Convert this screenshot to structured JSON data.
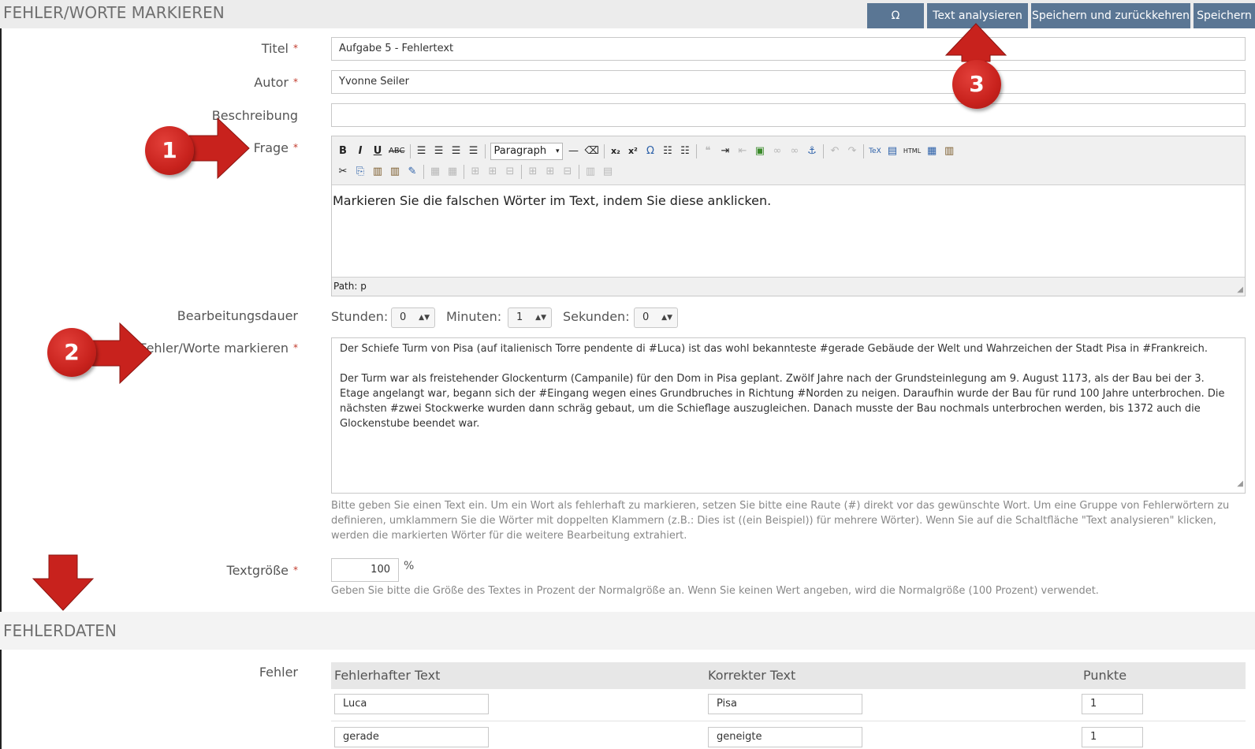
{
  "header": {
    "title": "FEHLER/WORTE MARKIEREN",
    "buttons": {
      "omega": "Ω",
      "analyze": "Text analysieren",
      "save_return": "Speichern und zurückkehren",
      "save": "Speichern"
    }
  },
  "form": {
    "titel": {
      "label": "Titel",
      "required_mark": "*",
      "value": "Aufgabe 5 - Fehlertext"
    },
    "autor": {
      "label": "Autor",
      "required_mark": "*",
      "value": "Yvonne Seiler"
    },
    "beschreibung": {
      "label": "Beschreibung",
      "value": ""
    },
    "frage": {
      "label": "Frage",
      "required_mark": "*",
      "paragraph_format": "Paragraph",
      "content": "Markieren Sie die falschen Wörter im Text, indem Sie diese anklicken.",
      "path": "Path: p"
    },
    "bearbeitungsdauer": {
      "label": "Bearbeitungsdauer",
      "stunden_label": "Stunden:",
      "stunden_value": "0",
      "minuten_label": "Minuten:",
      "minuten_value": "1",
      "sekunden_label": "Sekunden:",
      "sekunden_value": "0"
    },
    "fehler_worte": {
      "label": "Fehler/Worte markieren",
      "required_mark": "*",
      "paragraph1": "Der Schiefe Turm von Pisa (auf italienisch Torre pendente di #Luca) ist das wohl bekannteste #gerade Gebäude der Welt und Wahrzeichen der Stadt Pisa in #Frankreich.",
      "paragraph2": "Der Turm war als freistehender Glockenturm (Campanile) für den Dom in Pisa geplant. Zwölf Jahre nach der Grundsteinlegung am 9. August 1173, als der Bau bei der 3. Etage angelangt war, begann sich der #Eingang wegen eines Grundbruches in Richtung #Norden zu neigen. Daraufhin wurde der Bau für rund 100 Jahre unterbrochen. Die nächsten #zwei Stockwerke wurden dann schräg gebaut, um die Schieflage auszugleichen. Danach musste der Bau nochmals unterbrochen werden, bis 1372 auch die Glockenstube beendet war.",
      "help_line1": "Bitte geben Sie einen Text ein. Um ein Wort als fehlerhaft zu markieren, setzen Sie bitte eine Raute (#) direkt vor das gewünschte Wort. Um eine Gruppe von Fehlerwörtern zu",
      "help_line2": "definieren, umklammern Sie die Wörter mit doppelten Klammern (z.B.: Dies ist ((ein Beispiel)) für mehrere Wörter). Wenn Sie auf die Schaltfläche \"Text analysieren\" klicken,",
      "help_line3": "werden die markierten Wörter für die weitere Bearbeitung extrahiert."
    },
    "textgroesse": {
      "label": "Textgröße",
      "required_mark": "*",
      "value": "100",
      "unit": "%",
      "help": "Geben Sie bitte die Größe des Textes in Prozent der Normalgröße an. Wenn Sie keinen Wert angeben, wird die Normalgröße (100 Prozent) verwendet."
    }
  },
  "fehlerdaten": {
    "section_title": "FEHLERDATEN",
    "label": "Fehler",
    "columns": [
      "Fehlerhafter Text",
      "Korrekter Text",
      "Punkte"
    ],
    "rows": [
      {
        "wrong": "Luca",
        "correct": "Pisa",
        "points": "1"
      },
      {
        "wrong": "gerade",
        "correct": "geneigte",
        "points": "1"
      }
    ]
  },
  "markers": [
    "1",
    "2",
    "3"
  ],
  "colors": {
    "header_button": "#5a7694",
    "marker_red": "#c8221d",
    "required_star": "#c0392b"
  }
}
